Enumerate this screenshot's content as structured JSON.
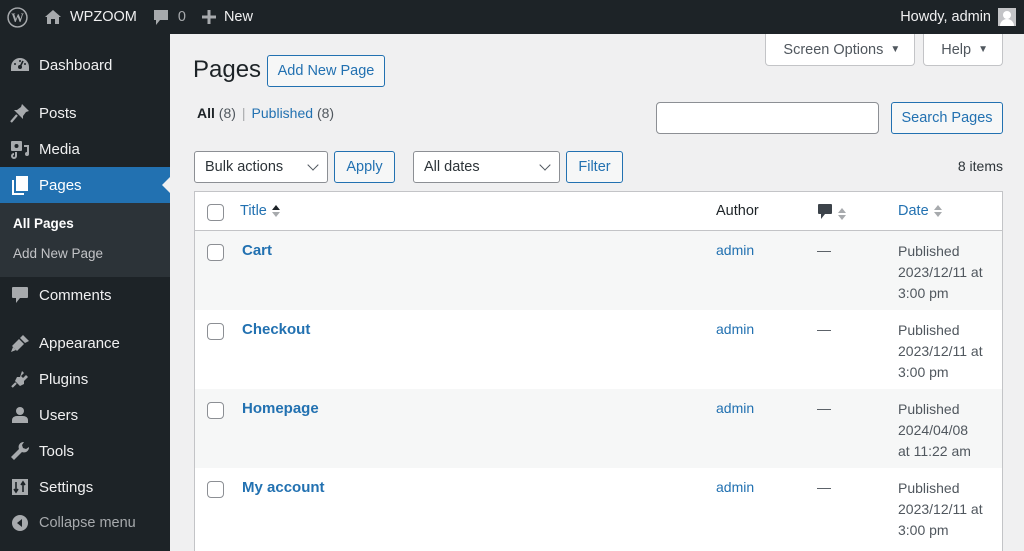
{
  "adminbar": {
    "site_name": "WPZOOM",
    "comments_count": "0",
    "new_label": "New",
    "greeting": "Howdy, admin"
  },
  "sidebar": {
    "items": [
      {
        "label": "Dashboard",
        "icon": "dashboard-icon"
      },
      {
        "label": "Posts",
        "icon": "pin-icon"
      },
      {
        "label": "Media",
        "icon": "media-icon"
      },
      {
        "label": "Pages",
        "icon": "pages-icon",
        "current": true
      },
      {
        "label": "Comments",
        "icon": "comment-icon"
      },
      {
        "label": "Appearance",
        "icon": "brush-icon"
      },
      {
        "label": "Plugins",
        "icon": "plug-icon"
      },
      {
        "label": "Users",
        "icon": "user-icon"
      },
      {
        "label": "Tools",
        "icon": "wrench-icon"
      },
      {
        "label": "Settings",
        "icon": "settings-icon"
      }
    ],
    "submenu": [
      {
        "label": "All Pages",
        "current": true
      },
      {
        "label": "Add New Page"
      }
    ],
    "collapse_label": "Collapse menu"
  },
  "screen_meta": {
    "screen_options": "Screen Options",
    "help": "Help"
  },
  "page": {
    "title": "Pages",
    "add_new": "Add New Page"
  },
  "filters": {
    "all_label": "All",
    "all_count": "(8)",
    "published_label": "Published",
    "published_count": "(8)",
    "separator": "|"
  },
  "search": {
    "value": "",
    "button": "Search Pages"
  },
  "tablenav": {
    "bulk_actions": "Bulk actions",
    "apply": "Apply",
    "dates": "All dates",
    "filter": "Filter",
    "items_count": "8 items"
  },
  "table": {
    "columns": {
      "title": "Title",
      "author": "Author",
      "date": "Date"
    },
    "rows": [
      {
        "title": "Cart",
        "author": "admin",
        "comments": "—",
        "status": "Published",
        "date_line1": "2023/12/11 at",
        "date_line2": "3:00 pm"
      },
      {
        "title": "Checkout",
        "author": "admin",
        "comments": "—",
        "status": "Published",
        "date_line1": "2023/12/11 at",
        "date_line2": "3:00 pm"
      },
      {
        "title": "Homepage",
        "author": "admin",
        "comments": "—",
        "status": "Published",
        "date_line1": "2024/04/08",
        "date_line2": "at 11:22 am"
      },
      {
        "title": "My account",
        "author": "admin",
        "comments": "—",
        "status": "Published",
        "date_line1": "2023/12/11 at",
        "date_line2": "3:00 pm"
      }
    ]
  },
  "colors": {
    "accent": "#2271b1",
    "admin_dark": "#1d2327",
    "submenu_bg": "#2c3338",
    "background": "#f0f0f1"
  }
}
